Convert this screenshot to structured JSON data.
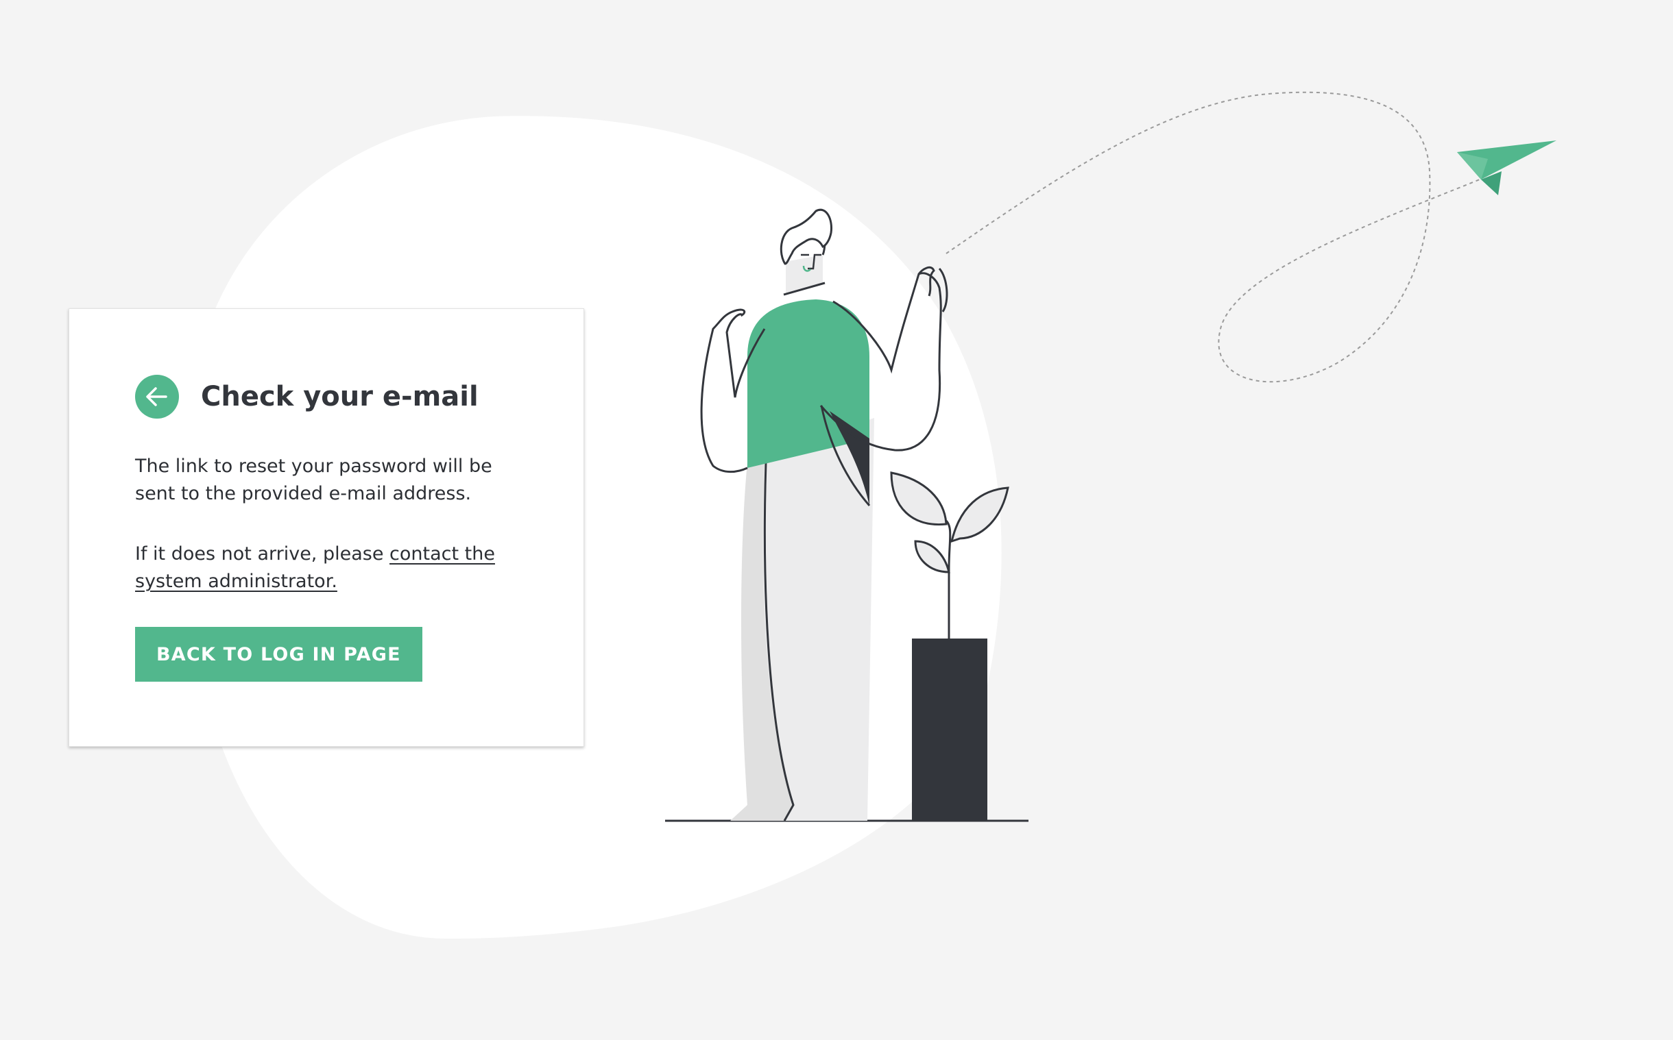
{
  "card": {
    "title": "Check your e-mail",
    "message": "The link to reset your password will be sent to the provided e-mail address.",
    "help_prefix": "If it does not arrive, please ",
    "help_link": "contact the system administrator.",
    "back_button": "BACK TO LOG IN PAGE",
    "back_icon": "arrow-left-icon"
  },
  "colors": {
    "accent": "#52b78d",
    "dark": "#33363c",
    "background": "#f4f4f4",
    "card": "#ffffff"
  },
  "illustration": {
    "icons": [
      "person-illustration",
      "plant-illustration",
      "paper-plane-icon",
      "flight-path"
    ]
  }
}
